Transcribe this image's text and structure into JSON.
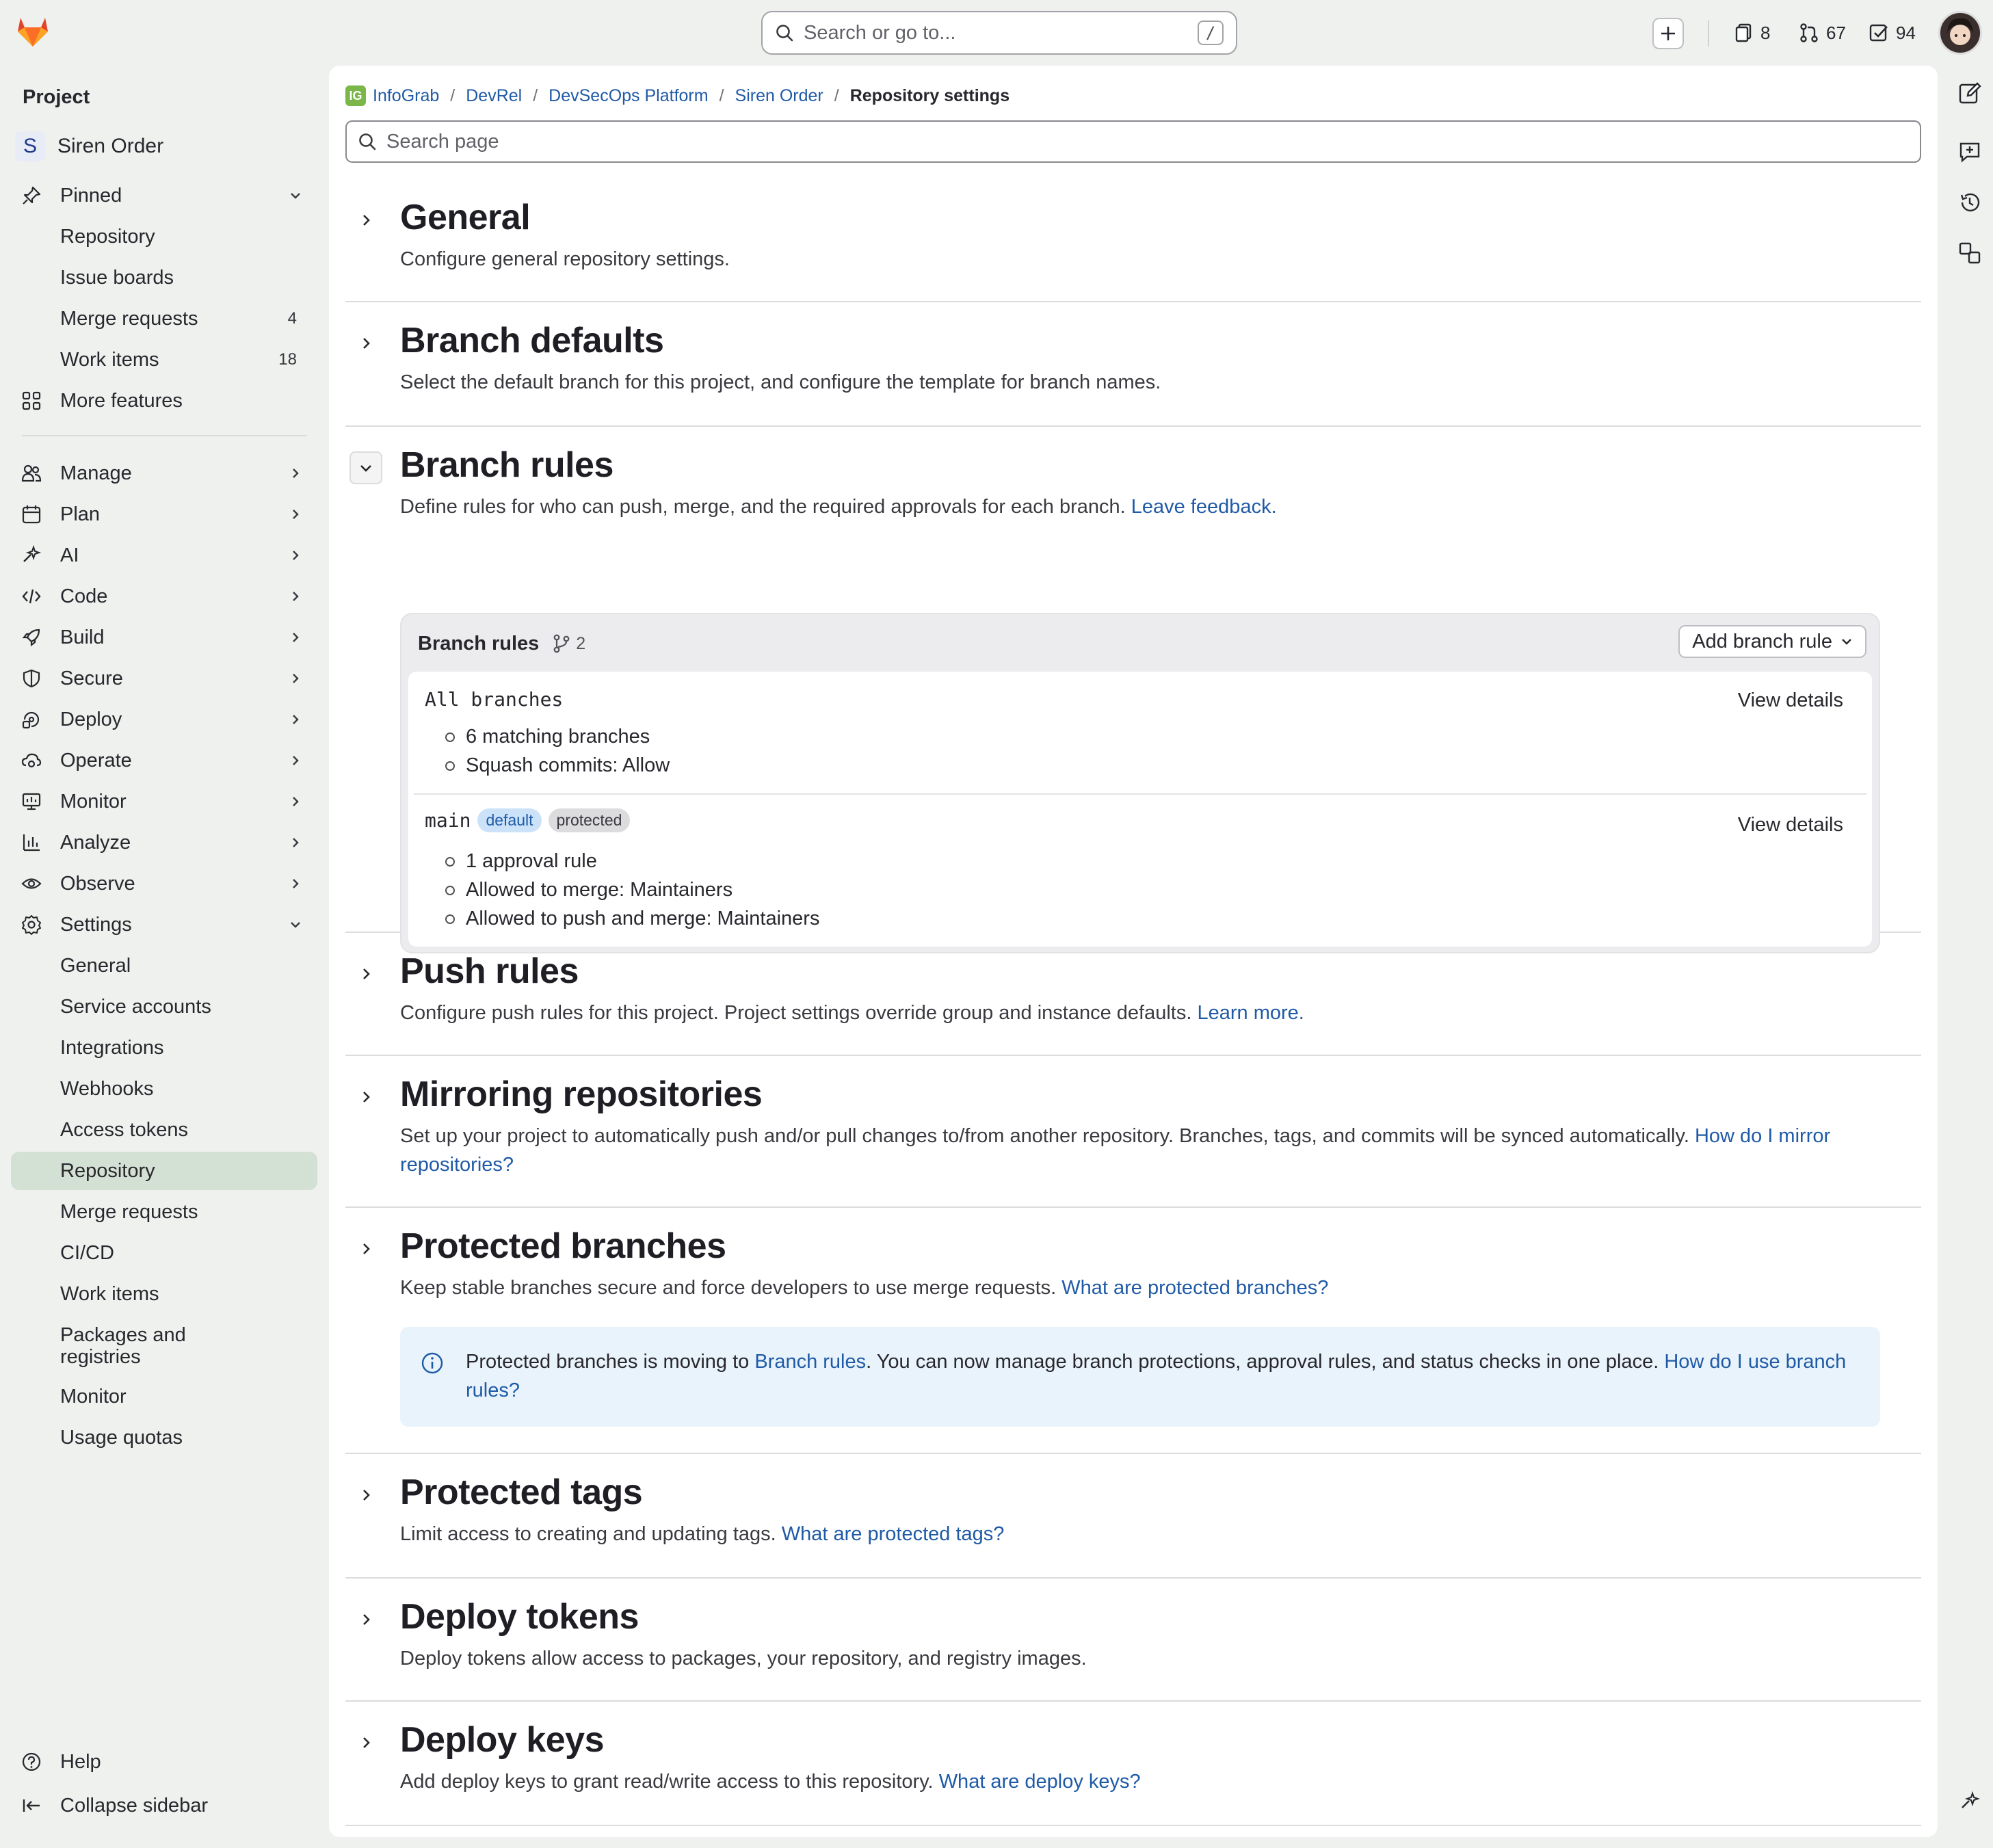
{
  "topbar": {
    "search_placeholder": "Search or go to...",
    "search_shortcut": "/",
    "issues_count": "8",
    "merge_requests_count": "67",
    "todos_count": "94"
  },
  "sidebar": {
    "title": "Project",
    "project_initial": "S",
    "project_name": "Siren Order",
    "pinned": {
      "label": "Pinned",
      "items": [
        {
          "label": "Repository",
          "count": ""
        },
        {
          "label": "Issue boards",
          "count": ""
        },
        {
          "label": "Merge requests",
          "count": "4"
        },
        {
          "label": "Work items",
          "count": "18"
        }
      ]
    },
    "more_features": "More features",
    "groups": [
      "Manage",
      "Plan",
      "AI",
      "Code",
      "Build",
      "Secure",
      "Deploy",
      "Operate",
      "Monitor",
      "Analyze",
      "Observe"
    ],
    "settings": {
      "label": "Settings",
      "items": [
        "General",
        "Service accounts",
        "Integrations",
        "Webhooks",
        "Access tokens",
        "Repository",
        "Merge requests",
        "CI/CD",
        "Work items",
        "Packages and registries",
        "Monitor",
        "Usage quotas"
      ],
      "active": "Repository"
    },
    "help": "Help",
    "collapse": "Collapse sidebar"
  },
  "breadcrumb": {
    "logo_text": "IG",
    "items": [
      "InfoGrab",
      "DevRel",
      "DevSecOps Platform",
      "Siren Order"
    ],
    "current": "Repository settings"
  },
  "page_search_placeholder": "Search page",
  "sections": {
    "general": {
      "title": "General",
      "desc": "Configure general repository settings."
    },
    "branch_defaults": {
      "title": "Branch defaults",
      "desc": "Select the default branch for this project, and configure the template for branch names."
    },
    "branch_rules": {
      "title": "Branch rules",
      "desc": "Define rules for who can push, merge, and the required approvals for each branch.",
      "link": "Leave feedback.",
      "card_title": "Branch rules",
      "card_count": "2",
      "add_button": "Add branch rule",
      "rules": [
        {
          "name": "All branches",
          "badges": [],
          "details": [
            "6 matching branches",
            "Squash commits: Allow"
          ],
          "action": "View details"
        },
        {
          "name": "main",
          "badges": [
            "default",
            "protected"
          ],
          "details": [
            "1 approval rule",
            "Allowed to merge: Maintainers",
            "Allowed to push and merge: Maintainers"
          ],
          "action": "View details"
        }
      ]
    },
    "push_rules": {
      "title": "Push rules",
      "desc": "Configure push rules for this project. Project settings override group and instance defaults.",
      "link": "Learn more."
    },
    "mirroring": {
      "title": "Mirroring repositories",
      "desc": "Set up your project to automatically push and/or pull changes to/from another repository. Branches, tags, and commits will be synced automatically.",
      "link": "How do I mirror repositories?"
    },
    "protected_branches": {
      "title": "Protected branches",
      "desc": "Keep stable branches secure and force developers to use merge requests.",
      "link": "What are protected branches?",
      "alert": {
        "pre": "Protected branches is moving to ",
        "link1": "Branch rules",
        "mid": ". You can now manage branch protections, approval rules, and status checks in one place. ",
        "link2": "How do I use branch rules?"
      }
    },
    "protected_tags": {
      "title": "Protected tags",
      "desc": "Limit access to creating and updating tags.",
      "link": "What are protected tags?"
    },
    "deploy_tokens": {
      "title": "Deploy tokens",
      "desc": "Deploy tokens allow access to packages, your repository, and registry images."
    },
    "deploy_keys": {
      "title": "Deploy keys",
      "desc": "Add deploy keys to grant read/write access to this repository.",
      "link": "What are deploy keys?"
    }
  }
}
